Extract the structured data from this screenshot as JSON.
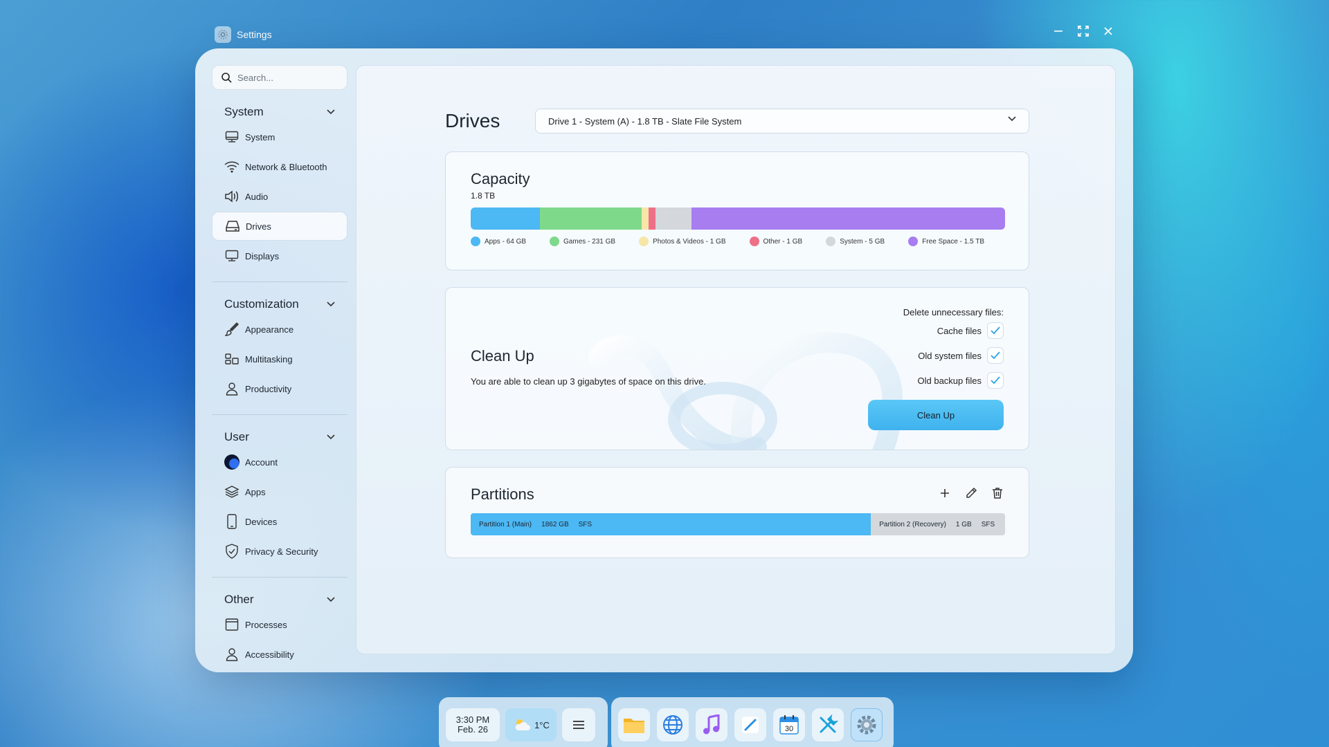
{
  "window": {
    "title": "Settings"
  },
  "sidebar": {
    "search_placeholder": "Search...",
    "groups": [
      {
        "title": "System",
        "items": [
          {
            "label": "System",
            "icon": "monitor-icon"
          },
          {
            "label": "Network & Bluetooth",
            "icon": "wifi-icon"
          },
          {
            "label": "Audio",
            "icon": "speaker-icon"
          },
          {
            "label": "Drives",
            "icon": "drive-icon",
            "active": true
          },
          {
            "label": "Displays",
            "icon": "display-icon"
          }
        ]
      },
      {
        "title": "Customization",
        "items": [
          {
            "label": "Appearance",
            "icon": "brush-icon"
          },
          {
            "label": "Multitasking",
            "icon": "multitasking-icon"
          },
          {
            "label": "Productivity",
            "icon": "person-icon"
          }
        ]
      },
      {
        "title": "User",
        "items": [
          {
            "label": "Account",
            "icon": "avatar-icon"
          },
          {
            "label": "Apps",
            "icon": "layers-icon"
          },
          {
            "label": "Devices",
            "icon": "phone-icon"
          },
          {
            "label": "Privacy & Security",
            "icon": "shield-icon"
          }
        ]
      },
      {
        "title": "Other",
        "items": [
          {
            "label": "Processes",
            "icon": "window-icon"
          },
          {
            "label": "Accessibility",
            "icon": "accessibility-icon"
          }
        ]
      }
    ]
  },
  "main": {
    "title": "Drives",
    "drive_select": "Drive 1 - System (A) - 1.8 TB - Slate File System",
    "capacity": {
      "title": "Capacity",
      "total": "1.8 TB",
      "segments": [
        {
          "label": "Apps - 64 GB",
          "color": "#4cb8f4",
          "fraction": 0.13
        },
        {
          "label": "Games - 231 GB",
          "color": "#7ed98a",
          "fraction": 0.19
        },
        {
          "label": "Photos & Videos - 1 GB",
          "color": "#f6e6a8",
          "fraction": 0.013
        },
        {
          "label": "Other - 1 GB",
          "color": "#ee7087",
          "fraction": 0.013
        },
        {
          "label": "System - 5 GB",
          "color": "#d4d8dd",
          "fraction": 0.067
        },
        {
          "label": "Free Space - 1.5 TB",
          "color": "#a77df0",
          "fraction": 0.587
        }
      ]
    },
    "cleanup": {
      "title": "Clean Up",
      "description": "You are able to clean up 3 gigabytes of space on this drive.",
      "delete_title": "Delete unnecessary files:",
      "options": [
        {
          "label": "Cache files",
          "checked": true
        },
        {
          "label": "Old system files",
          "checked": true
        },
        {
          "label": "Old backup files",
          "checked": true
        }
      ],
      "button": "Clean Up"
    },
    "partitions": {
      "title": "Partitions",
      "items": [
        {
          "name": "Partition 1 (Main)",
          "size": "1862 GB",
          "fs": "SFS",
          "fraction": 0.749,
          "color": "#4cb8f4"
        },
        {
          "name": "Partition 2 (Recovery)",
          "size": "1 GB",
          "fs": "SFS",
          "fraction": 0.251,
          "color": "#d4d8dd"
        }
      ]
    }
  },
  "taskbar": {
    "time": "3:30 PM",
    "date": "Feb. 26",
    "weather": "1°C",
    "apps": [
      {
        "name": "folder-icon"
      },
      {
        "name": "globe-icon"
      },
      {
        "name": "music-icon"
      },
      {
        "name": "notes-icon"
      },
      {
        "name": "calendar-icon",
        "text": "30"
      },
      {
        "name": "tools-icon"
      },
      {
        "name": "settings-icon",
        "active": true
      }
    ]
  }
}
